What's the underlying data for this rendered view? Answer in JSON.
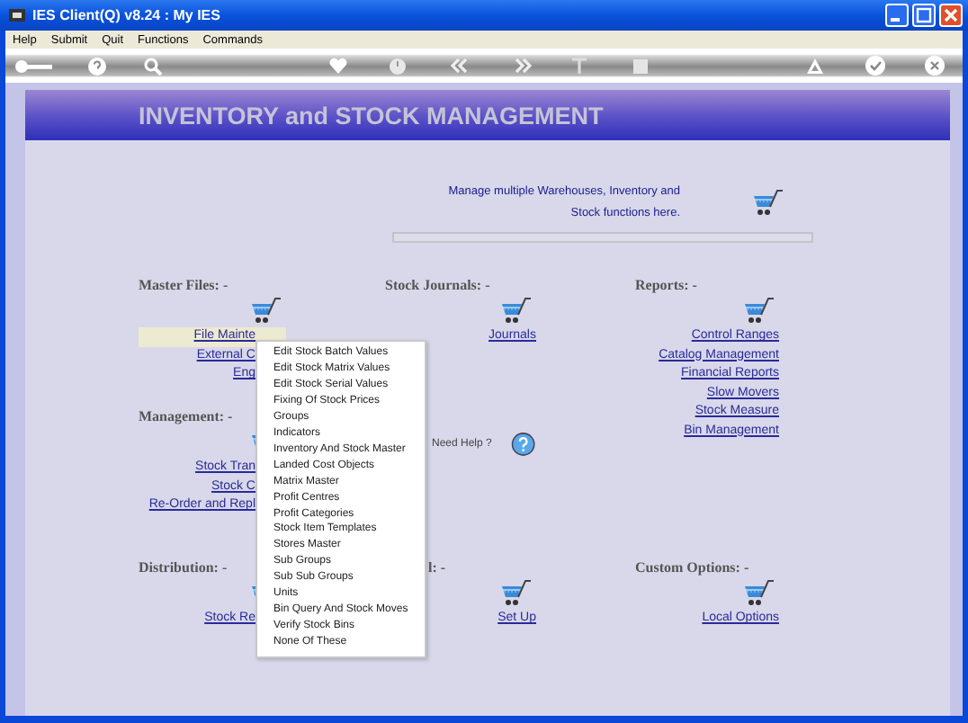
{
  "window": {
    "title": "IES Client(Q) v8.24 : My IES"
  },
  "menu_bar": [
    "Help",
    "Submit",
    "Quit",
    "Functions",
    "Commands"
  ],
  "page": {
    "title": "INVENTORY and STOCK MANAGEMENT",
    "description_lines": [
      "Manage multiple Warehouses, Inventory and",
      "Stock functions here."
    ]
  },
  "sections": [
    {
      "kind": "group",
      "heading": "Master Files: -",
      "links": [
        {
          "label": "File Mainte",
          "highlighted": true
        },
        {
          "label": "External C",
          "highlighted": false
        },
        {
          "label": "Eng",
          "highlighted": false
        }
      ]
    },
    {
      "kind": "group",
      "heading": "Stock Journals: -",
      "links": [
        {
          "label": "Journals",
          "highlighted": false
        }
      ]
    },
    {
      "kind": "group",
      "heading": "Reports: -",
      "links": [
        {
          "label": "Control Ranges",
          "highlighted": false
        },
        {
          "label": "Catalog Management",
          "highlighted": false
        },
        {
          "label": "Financial Reports",
          "highlighted": false
        },
        {
          "label": "Slow Movers",
          "highlighted": false
        },
        {
          "label": "Stock Measure",
          "highlighted": false
        },
        {
          "label": "Bin Management",
          "highlighted": false
        }
      ]
    },
    {
      "kind": "group",
      "heading": "Management: -",
      "links": [
        {
          "label": "Stock Tran",
          "highlighted": false
        },
        {
          "label": "Stock C",
          "highlighted": false
        },
        {
          "label": "Re-Order and Repl",
          "highlighted": false
        }
      ]
    },
    {
      "kind": "help",
      "label": "Need Help ?"
    },
    {
      "kind": "group",
      "heading": "Distribution: -",
      "links": [
        {
          "label": "Stock Re",
          "highlighted": false
        }
      ]
    },
    {
      "kind": "group",
      "heading": "l: -",
      "links": [
        {
          "label": "Set Up",
          "highlighted": false
        }
      ]
    },
    {
      "kind": "group",
      "heading": "Custom Options: -",
      "links": [
        {
          "label": "Local Options",
          "highlighted": false
        }
      ]
    }
  ],
  "popup_menu": {
    "items": [
      "Edit Stock Batch Values",
      "Edit Stock Matrix Values",
      "Edit Stock Serial Values",
      "Fixing Of Stock Prices",
      "Groups",
      "Indicators",
      "Inventory And Stock Master",
      "Landed Cost Objects",
      "Matrix Master",
      "Profit Centres",
      "Profit Categories",
      "Stock Item Templates",
      "Stores Master",
      "Sub Groups",
      "Sub Sub Groups",
      "Units",
      "Bin Query And Stock Moves",
      "Verify Stock Bins",
      "None Of These"
    ]
  }
}
